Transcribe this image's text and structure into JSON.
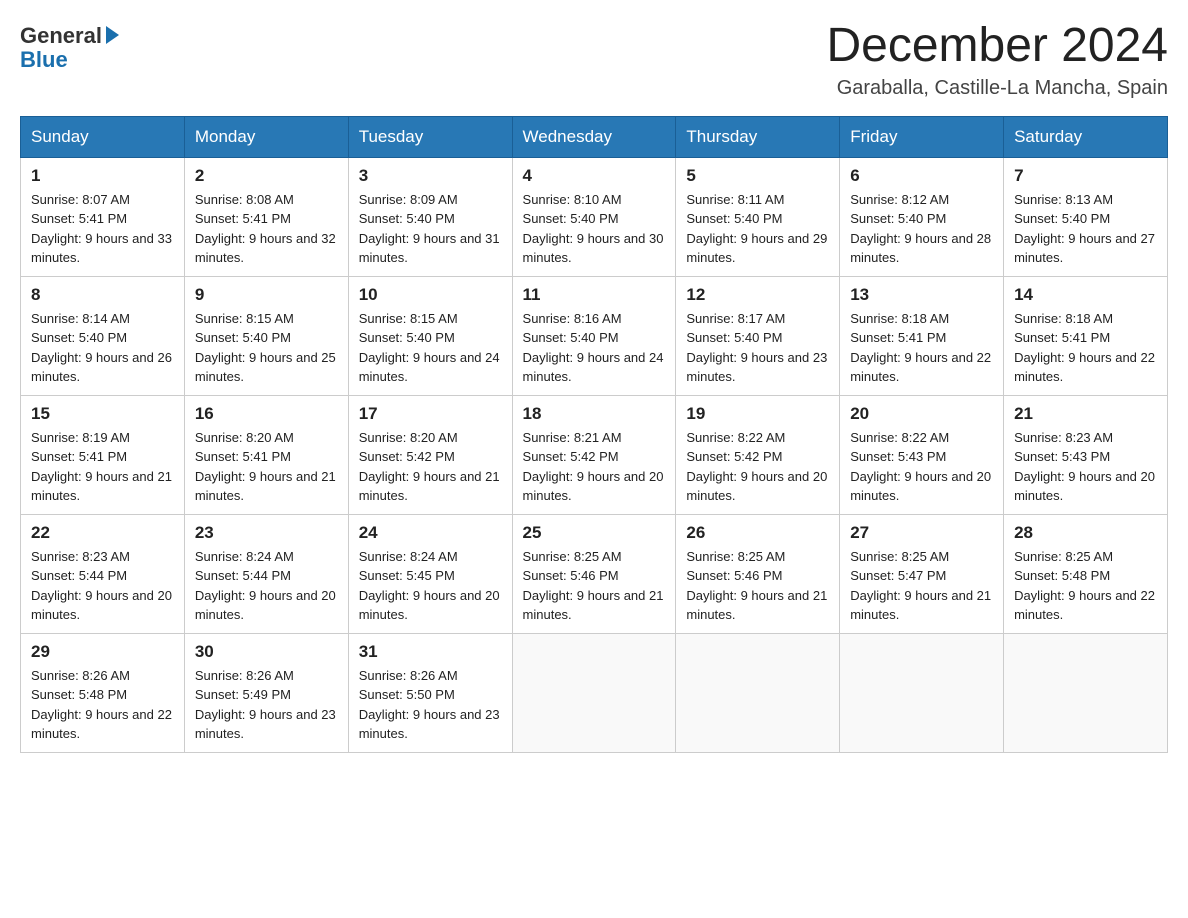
{
  "logo": {
    "text1": "General",
    "text2": "Blue"
  },
  "title": "December 2024",
  "subtitle": "Garaballa, Castille-La Mancha, Spain",
  "days_of_week": [
    "Sunday",
    "Monday",
    "Tuesday",
    "Wednesday",
    "Thursday",
    "Friday",
    "Saturday"
  ],
  "weeks": [
    [
      {
        "day": "1",
        "sunrise": "8:07 AM",
        "sunset": "5:41 PM",
        "daylight": "9 hours and 33 minutes."
      },
      {
        "day": "2",
        "sunrise": "8:08 AM",
        "sunset": "5:41 PM",
        "daylight": "9 hours and 32 minutes."
      },
      {
        "day": "3",
        "sunrise": "8:09 AM",
        "sunset": "5:40 PM",
        "daylight": "9 hours and 31 minutes."
      },
      {
        "day": "4",
        "sunrise": "8:10 AM",
        "sunset": "5:40 PM",
        "daylight": "9 hours and 30 minutes."
      },
      {
        "day": "5",
        "sunrise": "8:11 AM",
        "sunset": "5:40 PM",
        "daylight": "9 hours and 29 minutes."
      },
      {
        "day": "6",
        "sunrise": "8:12 AM",
        "sunset": "5:40 PM",
        "daylight": "9 hours and 28 minutes."
      },
      {
        "day": "7",
        "sunrise": "8:13 AM",
        "sunset": "5:40 PM",
        "daylight": "9 hours and 27 minutes."
      }
    ],
    [
      {
        "day": "8",
        "sunrise": "8:14 AM",
        "sunset": "5:40 PM",
        "daylight": "9 hours and 26 minutes."
      },
      {
        "day": "9",
        "sunrise": "8:15 AM",
        "sunset": "5:40 PM",
        "daylight": "9 hours and 25 minutes."
      },
      {
        "day": "10",
        "sunrise": "8:15 AM",
        "sunset": "5:40 PM",
        "daylight": "9 hours and 24 minutes."
      },
      {
        "day": "11",
        "sunrise": "8:16 AM",
        "sunset": "5:40 PM",
        "daylight": "9 hours and 24 minutes."
      },
      {
        "day": "12",
        "sunrise": "8:17 AM",
        "sunset": "5:40 PM",
        "daylight": "9 hours and 23 minutes."
      },
      {
        "day": "13",
        "sunrise": "8:18 AM",
        "sunset": "5:41 PM",
        "daylight": "9 hours and 22 minutes."
      },
      {
        "day": "14",
        "sunrise": "8:18 AM",
        "sunset": "5:41 PM",
        "daylight": "9 hours and 22 minutes."
      }
    ],
    [
      {
        "day": "15",
        "sunrise": "8:19 AM",
        "sunset": "5:41 PM",
        "daylight": "9 hours and 21 minutes."
      },
      {
        "day": "16",
        "sunrise": "8:20 AM",
        "sunset": "5:41 PM",
        "daylight": "9 hours and 21 minutes."
      },
      {
        "day": "17",
        "sunrise": "8:20 AM",
        "sunset": "5:42 PM",
        "daylight": "9 hours and 21 minutes."
      },
      {
        "day": "18",
        "sunrise": "8:21 AM",
        "sunset": "5:42 PM",
        "daylight": "9 hours and 20 minutes."
      },
      {
        "day": "19",
        "sunrise": "8:22 AM",
        "sunset": "5:42 PM",
        "daylight": "9 hours and 20 minutes."
      },
      {
        "day": "20",
        "sunrise": "8:22 AM",
        "sunset": "5:43 PM",
        "daylight": "9 hours and 20 minutes."
      },
      {
        "day": "21",
        "sunrise": "8:23 AM",
        "sunset": "5:43 PM",
        "daylight": "9 hours and 20 minutes."
      }
    ],
    [
      {
        "day": "22",
        "sunrise": "8:23 AM",
        "sunset": "5:44 PM",
        "daylight": "9 hours and 20 minutes."
      },
      {
        "day": "23",
        "sunrise": "8:24 AM",
        "sunset": "5:44 PM",
        "daylight": "9 hours and 20 minutes."
      },
      {
        "day": "24",
        "sunrise": "8:24 AM",
        "sunset": "5:45 PM",
        "daylight": "9 hours and 20 minutes."
      },
      {
        "day": "25",
        "sunrise": "8:25 AM",
        "sunset": "5:46 PM",
        "daylight": "9 hours and 21 minutes."
      },
      {
        "day": "26",
        "sunrise": "8:25 AM",
        "sunset": "5:46 PM",
        "daylight": "9 hours and 21 minutes."
      },
      {
        "day": "27",
        "sunrise": "8:25 AM",
        "sunset": "5:47 PM",
        "daylight": "9 hours and 21 minutes."
      },
      {
        "day": "28",
        "sunrise": "8:25 AM",
        "sunset": "5:48 PM",
        "daylight": "9 hours and 22 minutes."
      }
    ],
    [
      {
        "day": "29",
        "sunrise": "8:26 AM",
        "sunset": "5:48 PM",
        "daylight": "9 hours and 22 minutes."
      },
      {
        "day": "30",
        "sunrise": "8:26 AM",
        "sunset": "5:49 PM",
        "daylight": "9 hours and 23 minutes."
      },
      {
        "day": "31",
        "sunrise": "8:26 AM",
        "sunset": "5:50 PM",
        "daylight": "9 hours and 23 minutes."
      },
      null,
      null,
      null,
      null
    ]
  ]
}
